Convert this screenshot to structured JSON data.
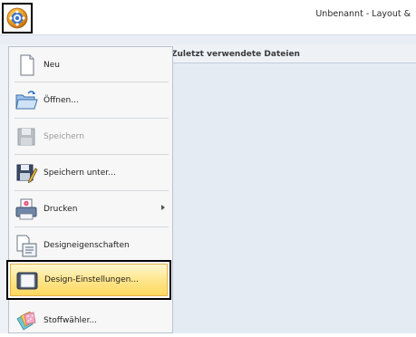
{
  "window": {
    "title": "Unbenannt - Layout &"
  },
  "file_menu": {
    "items": [
      {
        "label": "Neu",
        "icon": "new-document-icon",
        "enabled": true
      },
      {
        "label": "Öffnen...",
        "icon": "open-folder-icon",
        "enabled": true
      },
      {
        "label": "Speichern",
        "icon": "save-icon",
        "enabled": false
      },
      {
        "label": "Speichern unter...",
        "icon": "save-as-icon",
        "enabled": true
      },
      {
        "label": "Drucken",
        "icon": "printer-icon",
        "enabled": true,
        "has_submenu": true
      },
      {
        "label": "Designeigenschaften",
        "icon": "design-properties-icon",
        "enabled": true
      },
      {
        "label": "Design-Einstellungen...",
        "icon": "design-settings-icon",
        "enabled": true,
        "highlighted": true
      },
      {
        "label": "Stoffwähler...",
        "icon": "fabric-selector-icon",
        "enabled": true
      }
    ]
  },
  "recent_files": {
    "title": "Zuletzt verwendete Dateien"
  },
  "colors": {
    "highlight_top": "#fff7cf",
    "highlight_bottom": "#ffd85e",
    "panel_bg": "#e4ebf3"
  }
}
